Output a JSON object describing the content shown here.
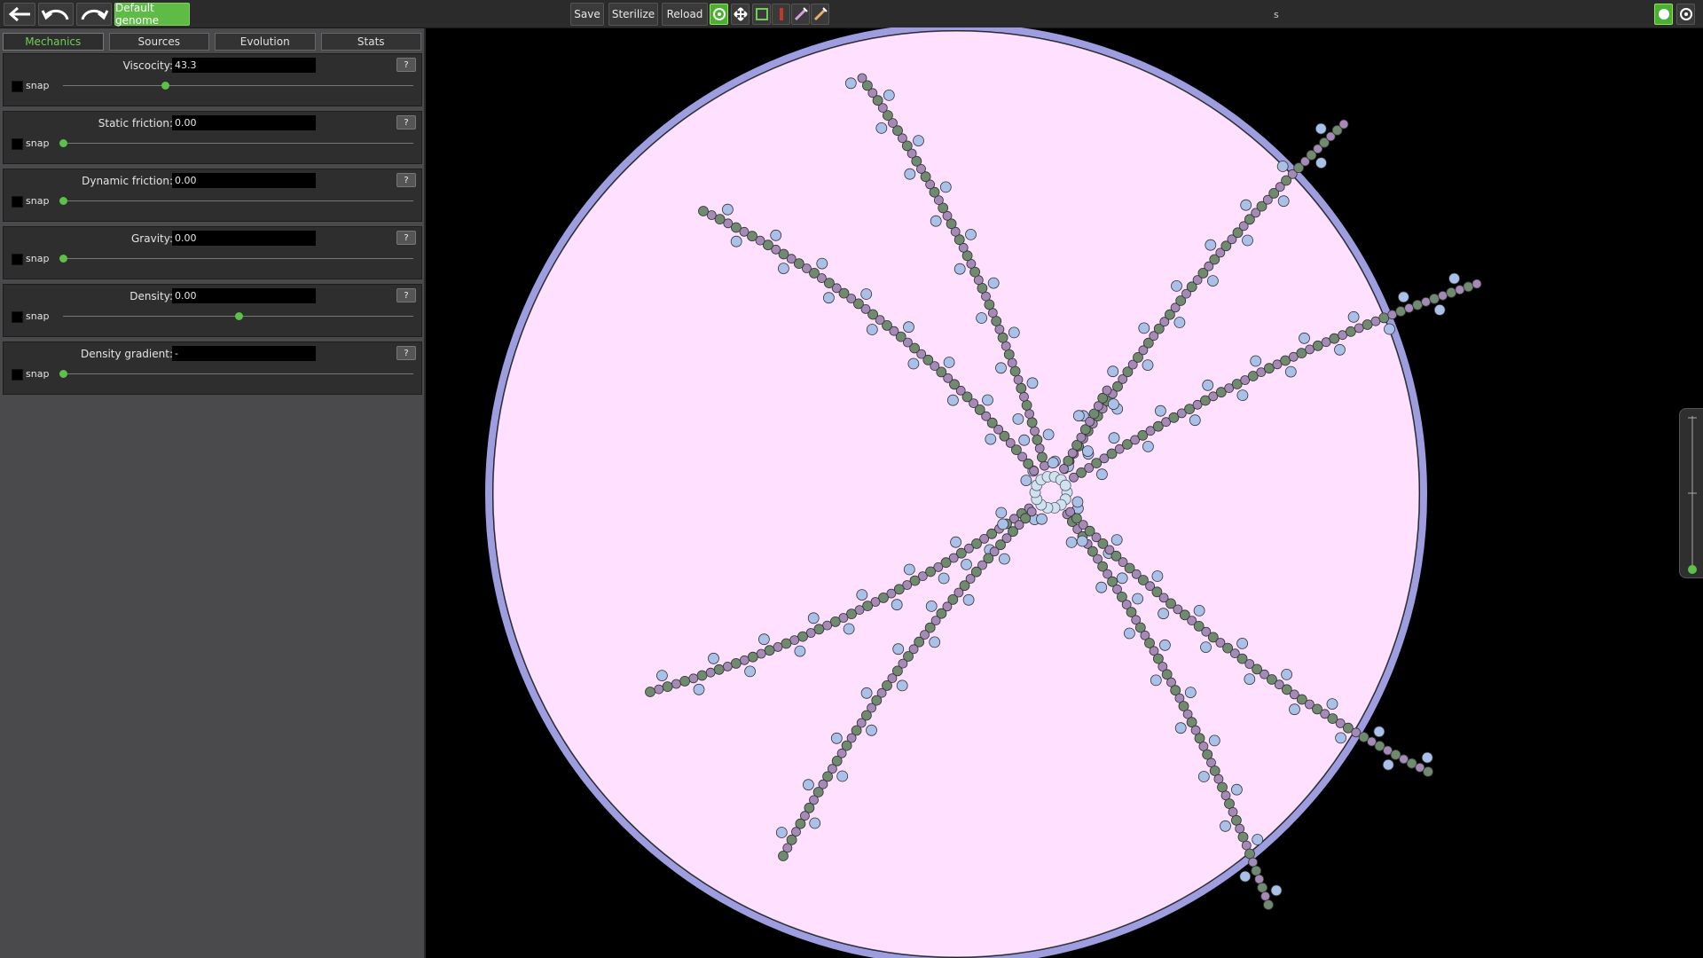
{
  "toolbar": {
    "back_icon": "arrow-left-icon",
    "undo_icon": "undo-icon",
    "redo_icon": "redo-icon",
    "genome_label": "Default genome",
    "save_label": "Save",
    "sterilize_label": "Sterilize",
    "reload_label": "Reload",
    "tools": [
      "target-tool-icon",
      "move-tool-icon",
      "select-box-tool-icon",
      "knife-tool-icon",
      "syringe-tool-icon",
      "laser-tool-icon"
    ],
    "status_text": "s",
    "right_icons": [
      "circle-toggle-icon",
      "eye-settings-icon"
    ]
  },
  "tabs": [
    "Mechanics",
    "Sources",
    "Evolution",
    "Stats"
  ],
  "active_tab": "Mechanics",
  "params": [
    {
      "label": "Viscocity:",
      "value": "43.3",
      "snap": "snap",
      "help": "?",
      "level": 0.29
    },
    {
      "label": "Static friction:",
      "value": "0.00",
      "snap": "snap",
      "help": "?",
      "level": 0.0
    },
    {
      "label": "Dynamic friction:",
      "value": "0.00",
      "snap": "snap",
      "help": "?",
      "level": 0.0
    },
    {
      "label": "Gravity:",
      "value": "0.00",
      "snap": "snap",
      "help": "?",
      "level": 0.0
    },
    {
      "label": "Density:",
      "value": "0.00",
      "snap": "snap",
      "help": "?",
      "level": 0.5
    },
    {
      "label": "Density gradient:",
      "value": "-",
      "snap": "snap",
      "help": "?",
      "level": 0.0
    }
  ],
  "colors": {
    "accent": "#5dbb46",
    "dish_fill": "#ffe0ff",
    "dish_rim": "#9d9ddf",
    "cell_core": "#6f8a6f",
    "cell_purple": "#a58ab8",
    "cell_blue": "#a9c0e8"
  },
  "zoom_slider_level": 0.0
}
